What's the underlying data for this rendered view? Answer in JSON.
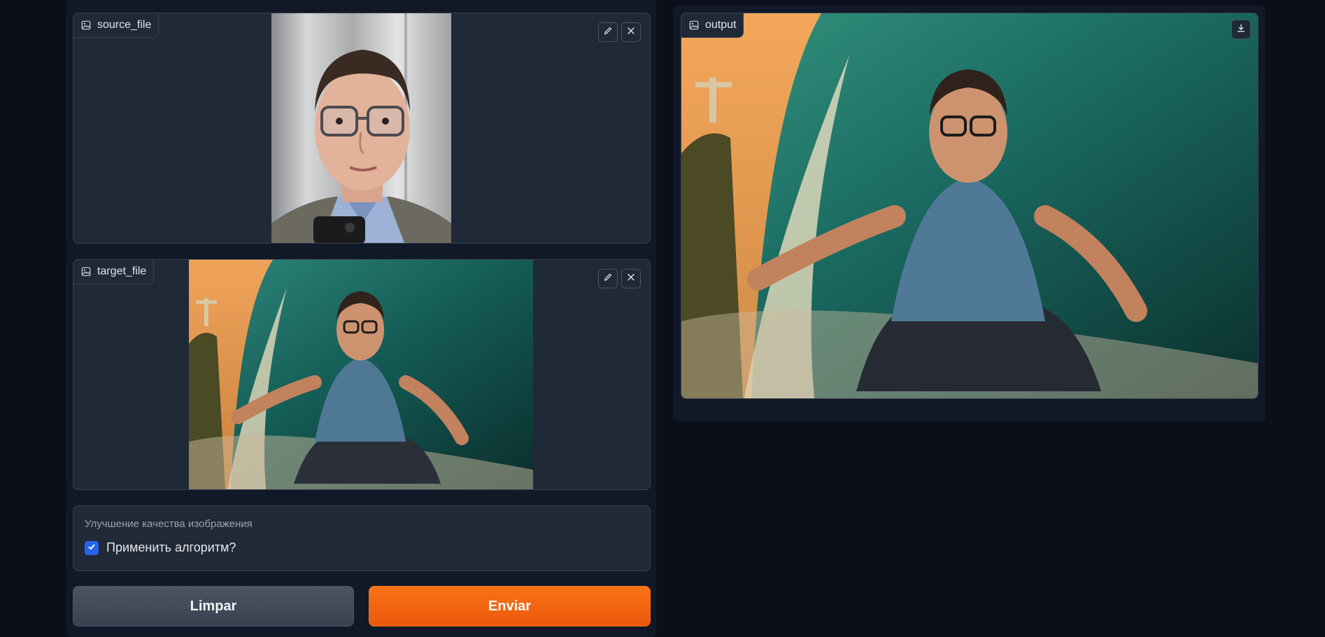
{
  "source": {
    "label": "source_file",
    "edit_icon": "pencil-icon",
    "clear_icon": "close-icon",
    "photo_description_icon": "image-icon"
  },
  "target": {
    "label": "target_file",
    "edit_icon": "pencil-icon",
    "clear_icon": "close-icon"
  },
  "output": {
    "label": "output",
    "download_icon": "download-icon"
  },
  "enhancement": {
    "title": "Улучшение качества изображения",
    "checkbox_label": "Применить алгоритм?",
    "checked": true
  },
  "buttons": {
    "clear": "Limpar",
    "submit": "Enviar"
  },
  "colors": {
    "background": "#0b0f19",
    "panel": "#1f2937",
    "accent": "#f97316",
    "checkbox": "#2563eb"
  }
}
